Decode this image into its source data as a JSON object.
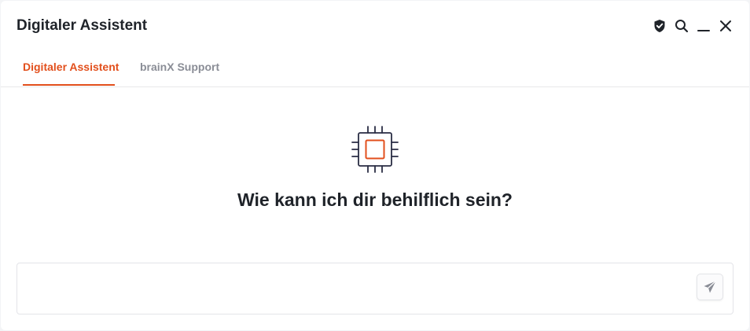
{
  "window": {
    "title": "Digitaler Assistent"
  },
  "header_actions": {
    "icons": [
      "shield-check-icon",
      "search-icon",
      "minimize-icon",
      "close-icon"
    ]
  },
  "tabs": [
    {
      "label": "Digitaler Assistent",
      "active": true
    },
    {
      "label": "brainX Support",
      "active": false
    }
  ],
  "main": {
    "icon": "cpu-chip-icon",
    "prompt": "Wie kann ich dir behilflich sein?"
  },
  "composer": {
    "value": "",
    "placeholder": "",
    "send_icon": "send-icon"
  },
  "colors": {
    "accent": "#e24f1c",
    "text": "#1f2329",
    "muted": "#8a8d96",
    "chip_outline": "#2a2d44",
    "border": "#e3e4e8"
  }
}
